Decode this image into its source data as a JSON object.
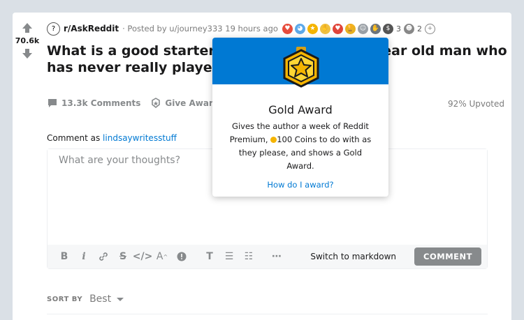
{
  "post": {
    "score": "70.6k",
    "subreddit": "r/AskReddit",
    "posted_by": "· Posted by u/journey333 19 hours ago",
    "title": "What is a good starter video game for a 30 year old man who has never really played before?",
    "award_counts": [
      "3",
      "2"
    ],
    "comments_label": "13.3k Comments",
    "give_award_label": "Give Award",
    "upvoted": "92% Upvoted"
  },
  "comment_box": {
    "comment_as": "Comment as",
    "username": "lindsaywritesstuff",
    "placeholder": "What are your thoughts?",
    "markdown_label": "Switch to markdown",
    "submit_label": "COMMENT"
  },
  "sort": {
    "label": "SORT BY",
    "value": "Best"
  },
  "award_popup": {
    "title": "Gold Award",
    "desc_before_coin": "Gives the author a week of Reddit Premium, ",
    "desc_after_coin": "100 Coins to do with as they please, and shows a Gold Award.",
    "link": "How do I award?"
  },
  "colors": {
    "accent": "#0079d3",
    "gold": "#f5b400",
    "muted": "#878a8c"
  }
}
